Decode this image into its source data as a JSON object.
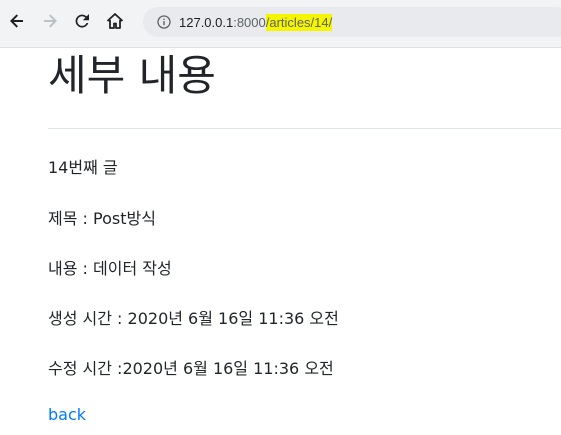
{
  "browser": {
    "url_host": "127.0.0.1",
    "url_port": ":8000",
    "url_path": "/articles/14/",
    "icons": {
      "back": "arrow-left-icon",
      "forward": "arrow-right-icon",
      "reload": "reload-icon",
      "home": "home-icon",
      "info": "info-icon"
    },
    "highlight_color": "#f6f500"
  },
  "page": {
    "title": "세부 내용",
    "article_number": "14번째 글",
    "title_line": "제목 : Post방식",
    "content_line": "내용 : 데이터 작성",
    "created_line": "생성 시간 : 2020년 6월 16일 11:36 오전",
    "updated_line": "수정 시간 :2020년 6월 16일 11:36 오전",
    "back_label": "back",
    "link_color": "#007bff"
  }
}
